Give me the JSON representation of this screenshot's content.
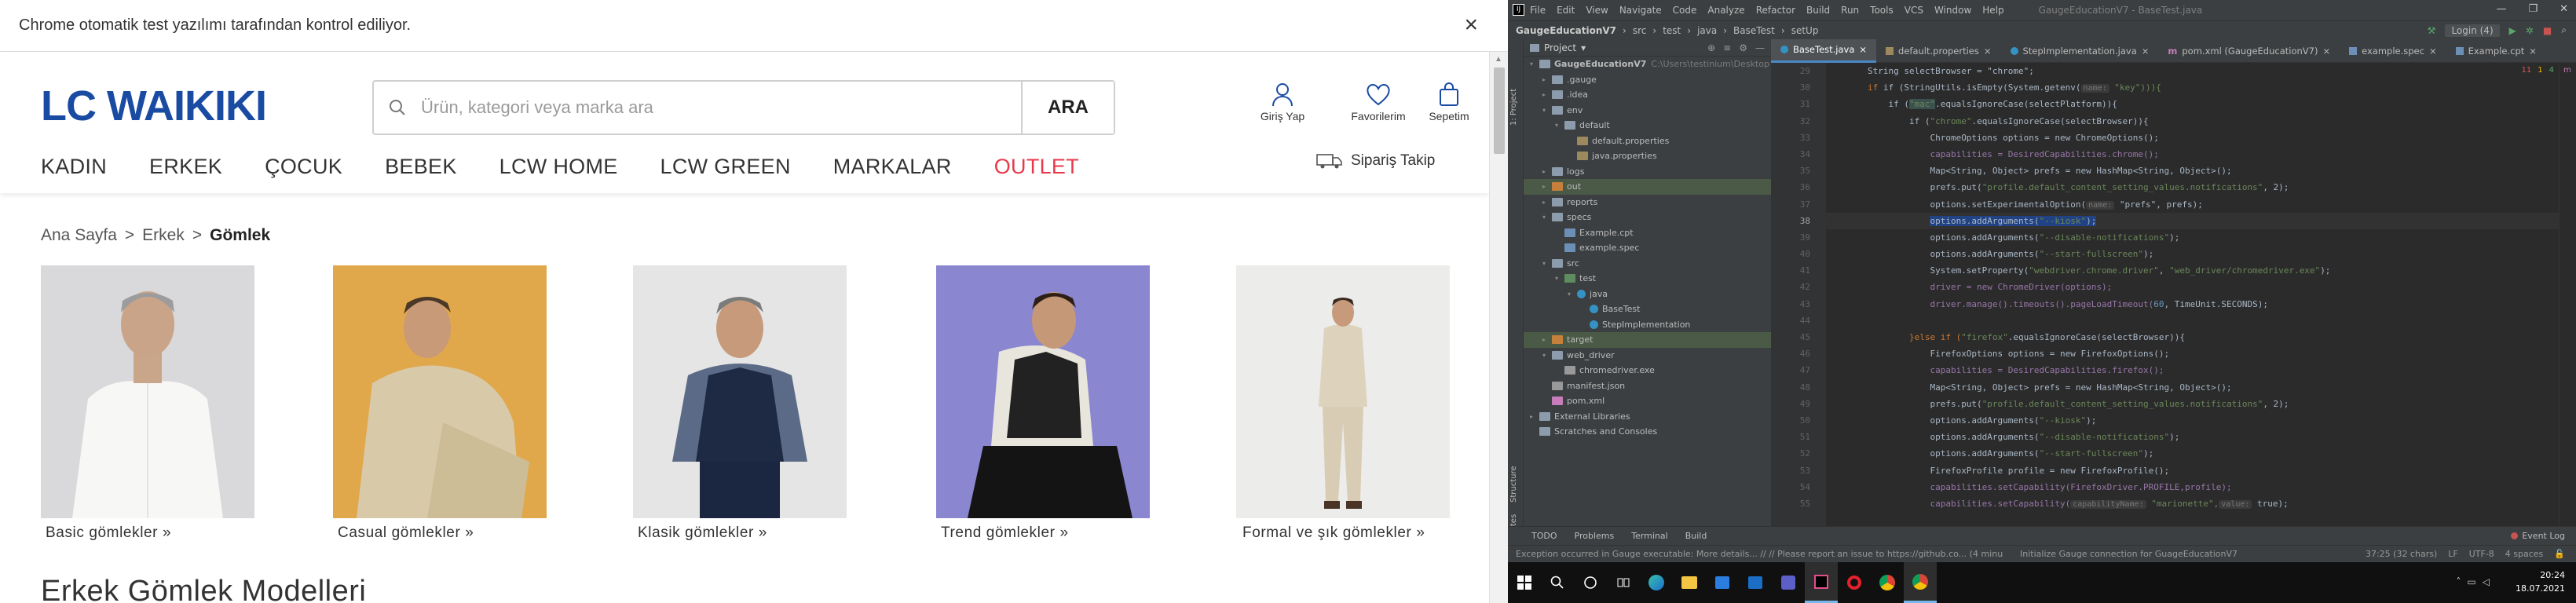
{
  "browser": {
    "infobar_text": "Chrome otomatik test yazılımı tarafından kontrol ediliyor.",
    "close_glyph": "×",
    "logo": "LC WAIKIKI",
    "search": {
      "placeholder": "Ürün, kategori veya marka ara",
      "button": "ARA"
    },
    "header_icons": [
      {
        "label": "Giriş Yap",
        "icon": "user-icon"
      },
      {
        "label": "Favorilerim",
        "icon": "heart-icon"
      },
      {
        "label": "Sepetim",
        "icon": "bag-icon"
      }
    ],
    "nav": [
      "KADIN",
      "ERKEK",
      "ÇOCUK",
      "BEBEK",
      "LCW HOME",
      "LCW GREEN",
      "MARKALAR",
      "OUTLET"
    ],
    "order_track": "Sipariş Takip",
    "breadcrumb": {
      "home": "Ana Sayfa",
      "sep": ">",
      "parent": "Erkek",
      "current": "Gömlek"
    },
    "categories": [
      {
        "label": "Basic gömlekler »"
      },
      {
        "label": "Casual gömlekler »"
      },
      {
        "label": "Klasik gömlekler »"
      },
      {
        "label": "Trend gömlekler »"
      },
      {
        "label": "Formal ve şık gömlekler »"
      }
    ],
    "section_title": "Erkek Gömlek Modelleri",
    "colors": {
      "brand_blue": "#1a4ba3",
      "outlet_red": "#e8394b"
    }
  },
  "ide": {
    "menu": [
      "File",
      "Edit",
      "View",
      "Navigate",
      "Code",
      "Analyze",
      "Refactor",
      "Build",
      "Run",
      "Tools",
      "VCS",
      "Window",
      "Help"
    ],
    "window_file": "GaugeEducationV7 - BaseTest.java",
    "breadcrumb": [
      "GaugeEducationV7",
      "src",
      "test",
      "java",
      "BaseTest",
      "setUp"
    ],
    "run_config": "Login (4)",
    "project_header": "Project",
    "tree": [
      {
        "label": "GaugeEducationV7",
        "dim": "C:\\Users\\testinium\\Desktop"
      },
      {
        "label": ".gauge"
      },
      {
        "label": ".idea"
      },
      {
        "label": "env"
      },
      {
        "label": "default"
      },
      {
        "label": "default.properties"
      },
      {
        "label": "java.properties"
      },
      {
        "label": "logs"
      },
      {
        "label": "out"
      },
      {
        "label": "reports"
      },
      {
        "label": "specs"
      },
      {
        "label": "Example.cpt"
      },
      {
        "label": "example.spec"
      },
      {
        "label": "src"
      },
      {
        "label": "test"
      },
      {
        "label": "java"
      },
      {
        "label": "BaseTest"
      },
      {
        "label": "StepImplementation"
      },
      {
        "label": "target"
      },
      {
        "label": "web_driver"
      },
      {
        "label": "chromedriver.exe"
      },
      {
        "label": "manifest.json"
      },
      {
        "label": "pom.xml"
      },
      {
        "label": "External Libraries"
      },
      {
        "label": "Scratches and Consoles"
      }
    ],
    "tabs": [
      "BaseTest.java",
      "default.properties",
      "StepImplementation.java",
      "pom.xml (GaugeEducationV7)",
      "example.spec",
      "Example.cpt"
    ],
    "inspections": {
      "errors": "11",
      "warnings": "1",
      "weak": "4"
    },
    "gutter": [
      "29",
      "30",
      "31",
      "32",
      "33",
      "34",
      "35",
      "36",
      "37",
      "38",
      "39",
      "40",
      "41",
      "42",
      "43",
      "44",
      "45",
      "46",
      "47",
      "48",
      "49",
      "50",
      "51",
      "52",
      "53",
      "54",
      "55"
    ],
    "code": {
      "l29": "String selectBrowser = \"chrome\";",
      "l30a": "if (StringUtils.isEmpty(System.getenv(",
      "l30h": "name:",
      "l30b": " \"key\"))){",
      "l31a": "if (",
      "l31s": "\"mac\"",
      "l31b": ".equalsIgnoreCase(selectPlatform)){",
      "l32a": "if (",
      "l32s": "\"chrome\"",
      "l32b": ".equalsIgnoreCase(selectBrowser)){",
      "l33": "ChromeOptions options = new ChromeOptions();",
      "l34": "capabilities = DesiredCapabilities.chrome();",
      "l35": "Map<String, Object> prefs = new HashMap<String, Object>();",
      "l36a": "prefs.put(",
      "l36s": "\"profile.default_content_setting_values.notifications\"",
      "l36b": ", 2);",
      "l37a": "options.setExperimentalOption(",
      "l37h": "name:",
      "l37b": " \"prefs\", prefs);",
      "l38a": "options.addArguments(",
      "l38s": "\"--kiosk\"",
      "l38b": ");",
      "l39s": "\"--disable-notifications\"",
      "l40s": "\"--start-fullscreen\"",
      "l41a": "System.setProperty(",
      "l41s1": "\"webdriver.chrome.driver\"",
      "l41s2": "\"web_driver/chromedriver.exe\"",
      "l42": "driver = new ChromeDriver(options);",
      "l43a": "driver.manage().timeouts().pageLoadTimeout(",
      "l43n": "60",
      "l43b": ", TimeUnit.SECONDS);",
      "l45a": "}else if (",
      "l45s": "\"firefox\"",
      "l45b": ".equalsIgnoreCase(selectBrowser)){",
      "l46": "FirefoxOptions options = new FirefoxOptions();",
      "l47": "capabilities = DesiredCapabilities.firefox();",
      "l48": "Map<String, Object> prefs = new HashMap<String, Object>();",
      "l49a": "prefs.put(",
      "l49s": "\"profile.default_content_setting_values.notifications\"",
      "l49b": ", 2);",
      "l50s": "\"--kiosk\"",
      "l51s": "\"--disable-notifications\"",
      "l52s": "\"--start-fullscreen\"",
      "l53": "FirefoxProfile profile = new FirefoxProfile();",
      "l54": "capabilities.setCapability(FirefoxDriver.PROFILE,profile);",
      "l55a": "capabilities.setCapability(",
      "l55h1": "capabilityName:",
      "l55s": " \"marionette\",",
      "l55h2": "value:",
      "l55b": " true);"
    },
    "bottom_tools": [
      "TODO",
      "Problems",
      "Terminal",
      "Build"
    ],
    "event_log": "Event Log",
    "status": {
      "message": "Exception occurred in Gauge executable: More details... // // Please report an issue to https://github.co... (4 minutes ago)",
      "message2": "Initialize Gauge connection for GuageEducationV7",
      "position": "37:25 (32 chars)",
      "line_sep": "LF",
      "encoding": "UTF-8",
      "indent": "4 spaces"
    }
  },
  "taskbar": {
    "time": "20:24",
    "date": "18.07.2021"
  }
}
